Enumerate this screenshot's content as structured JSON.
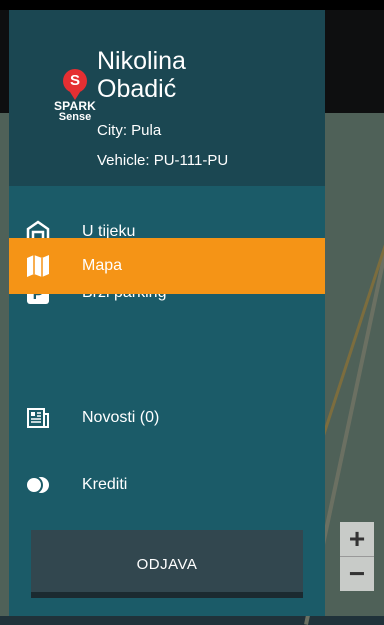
{
  "user": {
    "first_name": "Nikolina",
    "last_name": "Obadić",
    "city": "City: Pula",
    "vehicle": "Vehicle: PU-111-PU"
  },
  "logo": {
    "line1": "SPARK",
    "line2": "Sense"
  },
  "menu": [
    {
      "label": "U tijeku",
      "icon": "garage-icon",
      "active": false
    },
    {
      "label": "Brzi parking",
      "icon": "parking-icon",
      "active": false
    },
    {
      "label": "Mapa",
      "icon": "map-icon",
      "active": true
    },
    {
      "label": "Novosti (0)",
      "icon": "newspaper-icon",
      "active": false
    },
    {
      "label": "Krediti",
      "icon": "coins-icon",
      "active": false
    }
  ],
  "logout_label": "ODJAVA",
  "zoom": {
    "plus": "+",
    "minus": "−"
  },
  "colors": {
    "drawer": "#1b5b68",
    "header": "#1b4752",
    "active": "#f59416",
    "logo_red": "#e52f32"
  }
}
